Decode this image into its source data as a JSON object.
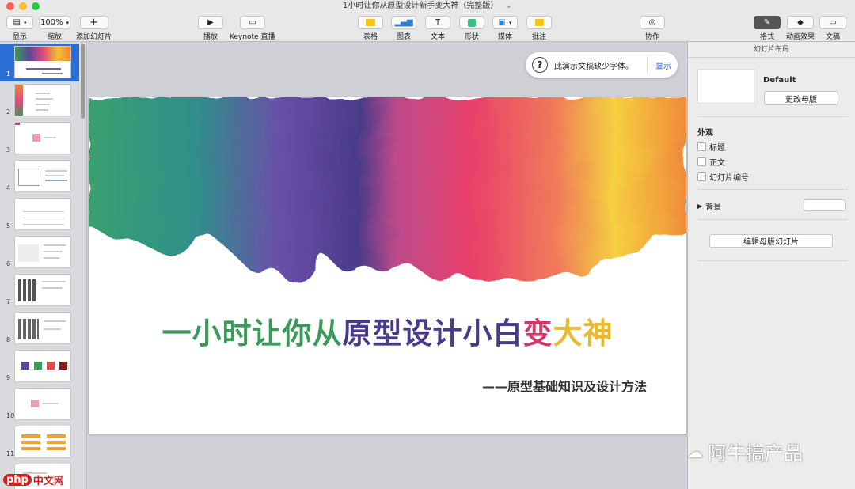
{
  "window": {
    "title": "1小时让你从原型设计新手变大神（完整版）"
  },
  "toolbar": {
    "view": "显示",
    "zoom_value": "100%",
    "zoom": "缩放",
    "add_slide": "添加幻灯片",
    "play": "播放",
    "keynote_live": "Keynote 直播",
    "table": "表格",
    "chart": "图表",
    "text": "文本",
    "shape": "形状",
    "media": "媒体",
    "comment": "批注",
    "collaborate": "协作",
    "format": "格式",
    "animate": "动画效果",
    "document": "文稿"
  },
  "notice": {
    "text": "此演示文稿缺少字体。",
    "show": "显示"
  },
  "slide": {
    "title_parts": [
      {
        "t": "一小时让你从",
        "c": "#3a9a5a"
      },
      {
        "t": "原型设计小白",
        "c": "#4b3a8c"
      },
      {
        "t": "变",
        "c": "#d0396a"
      },
      {
        "t": "大神",
        "c": "#e8b92e"
      }
    ],
    "subtitle": "——原型基础知识及设计方法"
  },
  "slides_nav": {
    "numbers": [
      "1",
      "2",
      "3",
      "4",
      "5",
      "6",
      "7",
      "8",
      "9",
      "10",
      "11"
    ]
  },
  "inspector": {
    "header": "幻灯片布局",
    "master_name": "Default",
    "change_master": "更改母版",
    "appearance": "外观",
    "opt_title": "标题",
    "opt_body": "正文",
    "opt_number": "幻灯片编号",
    "background": "背景",
    "edit_master": "编辑母版幻灯片"
  },
  "watermark": {
    "text": "阿牛搞产品"
  },
  "logo": {
    "brand": "php",
    "site": "中文网"
  }
}
